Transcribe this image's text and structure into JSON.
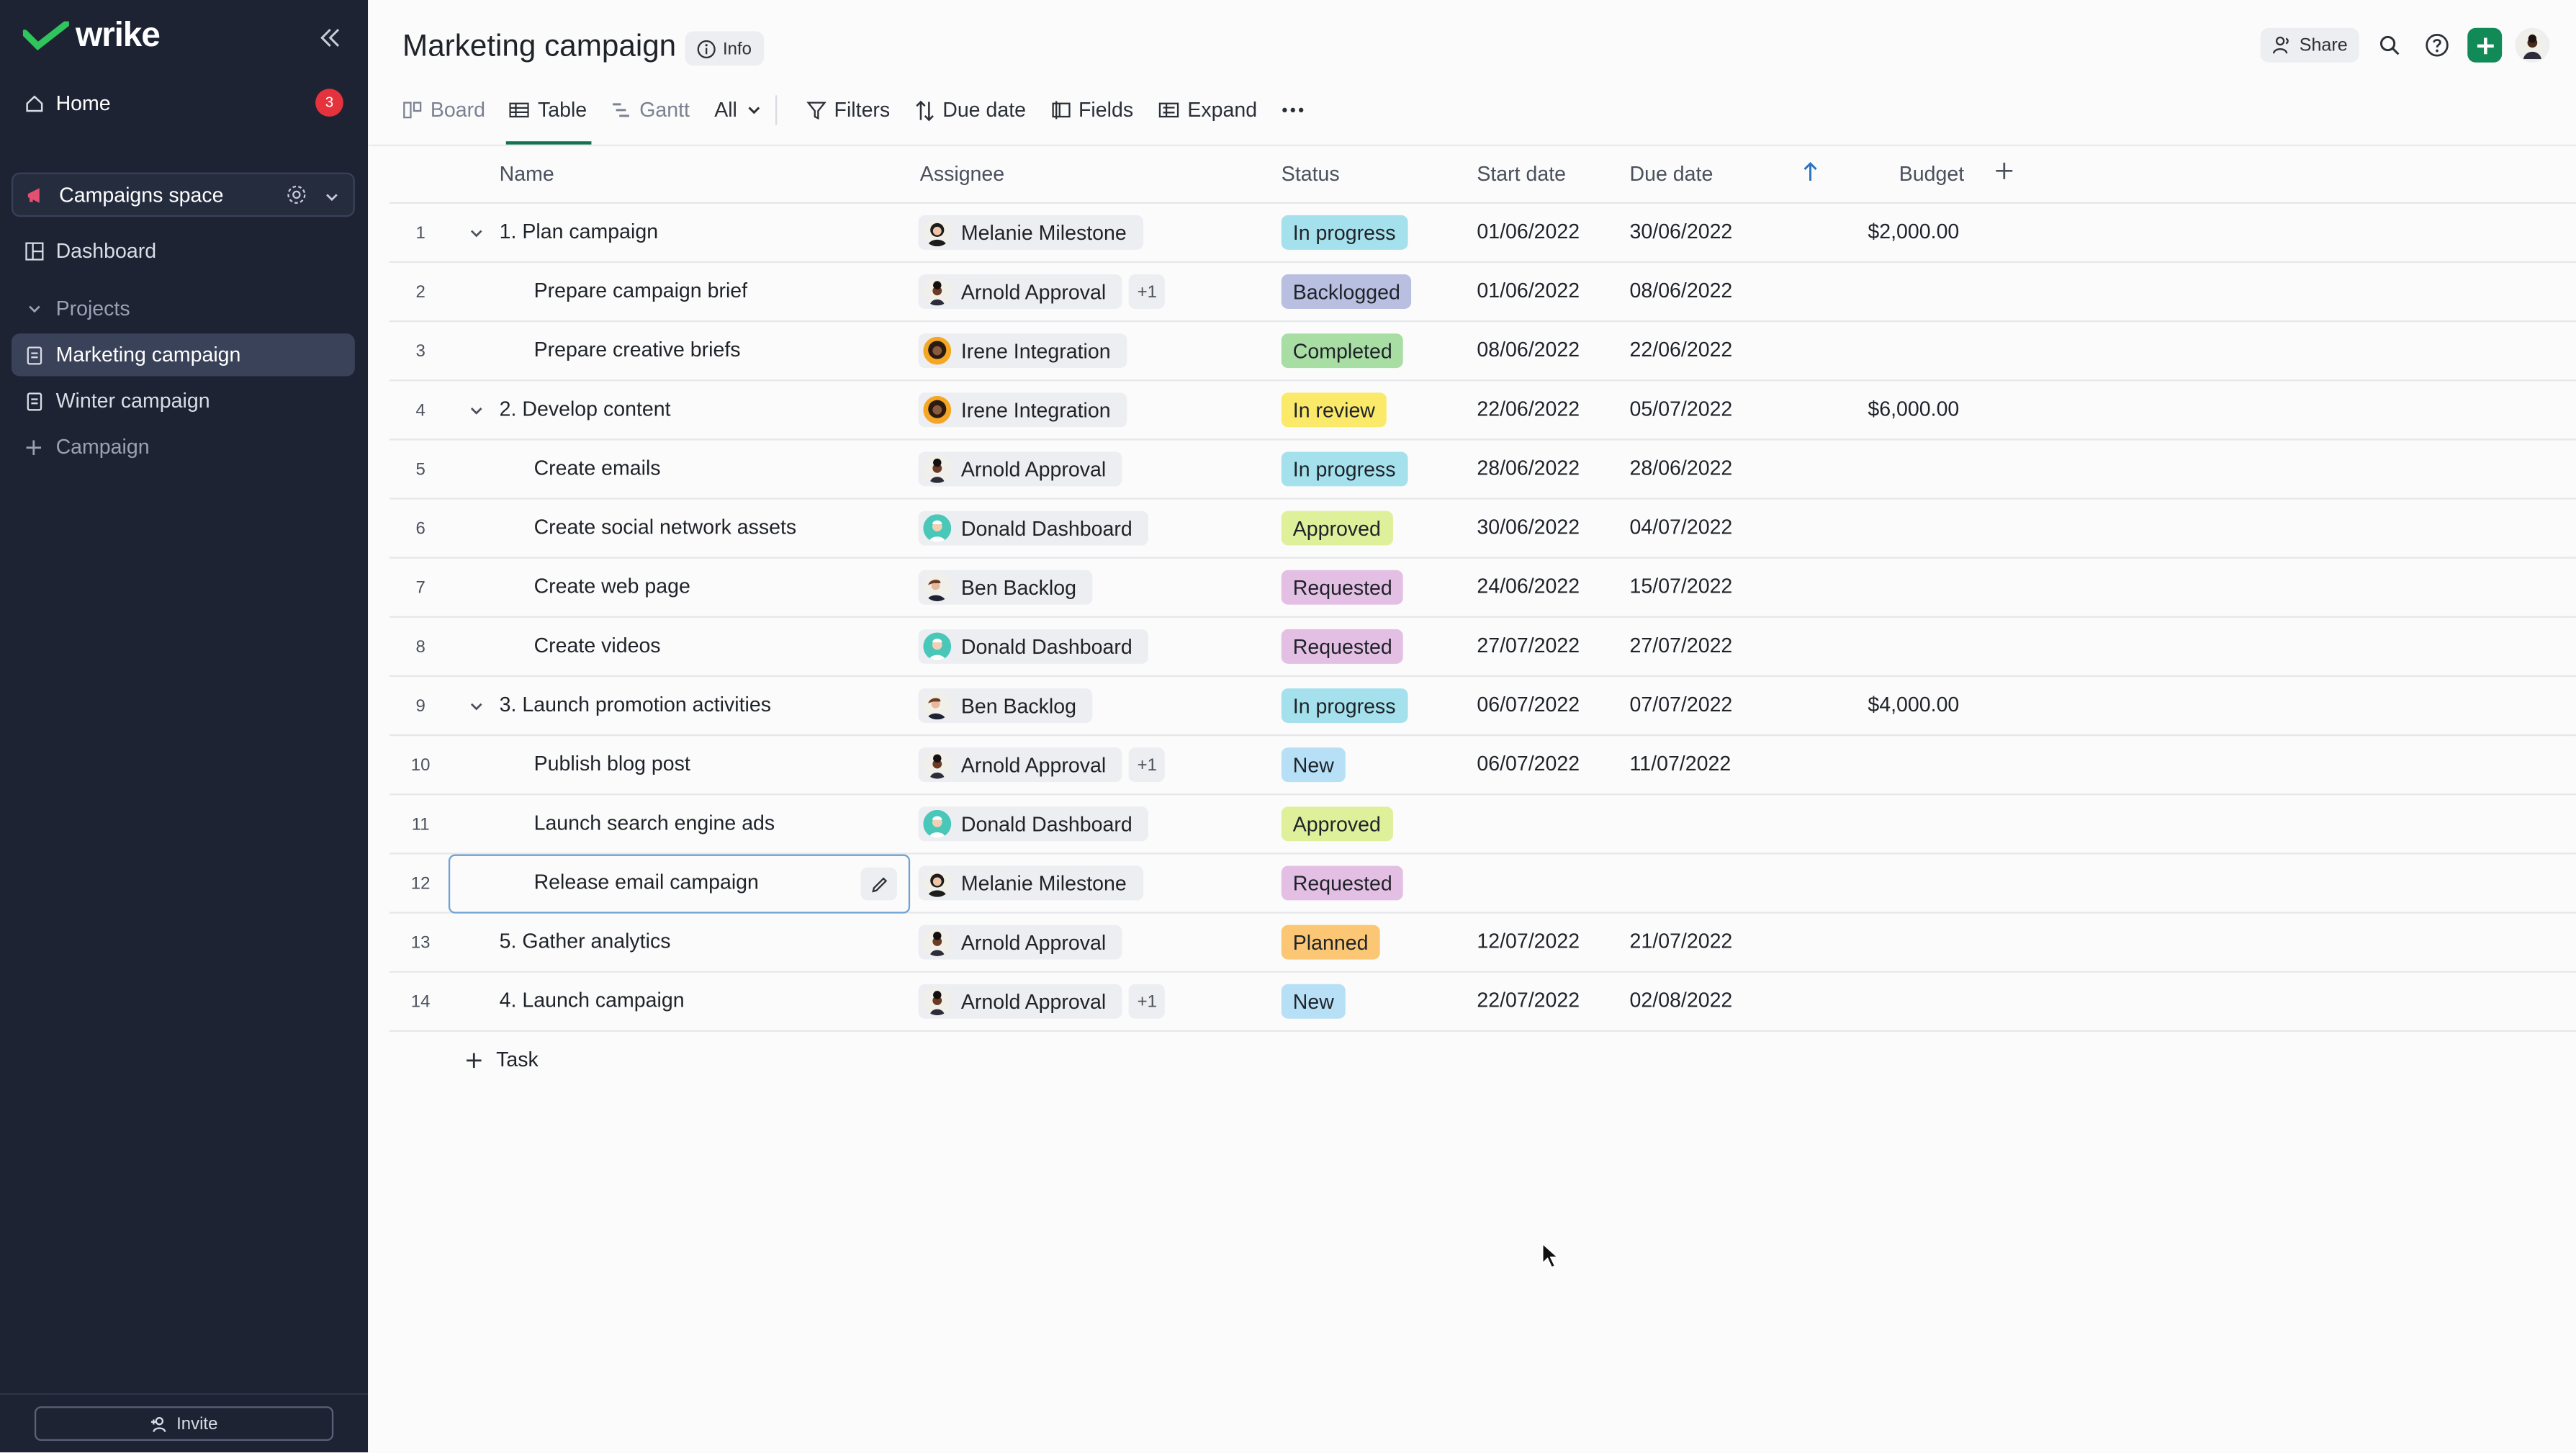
{
  "sidebar": {
    "logo": "wrike",
    "home": {
      "label": "Home",
      "badge": "3"
    },
    "space": {
      "label": "Campaigns space"
    },
    "items": [
      {
        "label": "Dashboard",
        "icon": "dashboard-icon"
      },
      {
        "label": "Projects",
        "icon": "chevron-down-icon"
      },
      {
        "label": "Marketing campaign",
        "icon": "project-icon"
      },
      {
        "label": "Winter campaign",
        "icon": "project-icon"
      },
      {
        "label": "Campaign",
        "icon": "plus-icon"
      }
    ],
    "invite": "Invite"
  },
  "header": {
    "title": "Marketing campaign",
    "info": "Info",
    "share": "Share"
  },
  "toolbar": {
    "views": [
      {
        "label": "Board"
      },
      {
        "label": "Table"
      },
      {
        "label": "Gantt"
      }
    ],
    "filter_scope": "All",
    "actions": [
      {
        "label": "Filters"
      },
      {
        "label": "Due date"
      },
      {
        "label": "Fields"
      },
      {
        "label": "Expand"
      }
    ]
  },
  "table": {
    "columns": {
      "name": "Name",
      "assignee": "Assignee",
      "status": "Status",
      "start": "Start date",
      "due": "Due date",
      "budget": "Budget"
    },
    "rows": [
      {
        "num": "1",
        "name": "1. Plan campaign",
        "assignee": "Melanie Milestone",
        "extra": "",
        "status": "In progress",
        "start": "01/06/2022",
        "due": "30/06/2022",
        "budget": "$2,000.00"
      },
      {
        "num": "2",
        "name": "Prepare campaign brief",
        "assignee": "Arnold Approval",
        "extra": "+1",
        "status": "Backlogged",
        "start": "01/06/2022",
        "due": "08/06/2022",
        "budget": ""
      },
      {
        "num": "3",
        "name": "Prepare creative briefs",
        "assignee": "Irene Integration",
        "extra": "",
        "status": "Completed",
        "start": "08/06/2022",
        "due": "22/06/2022",
        "budget": ""
      },
      {
        "num": "4",
        "name": "2. Develop content",
        "assignee": "Irene Integration",
        "extra": "",
        "status": "In review",
        "start": "22/06/2022",
        "due": "05/07/2022",
        "budget": "$6,000.00"
      },
      {
        "num": "5",
        "name": "Create emails",
        "assignee": "Arnold Approval",
        "extra": "",
        "status": "In progress",
        "start": "28/06/2022",
        "due": "28/06/2022",
        "budget": ""
      },
      {
        "num": "6",
        "name": "Create social network assets",
        "assignee": "Donald Dashboard",
        "extra": "",
        "status": "Approved",
        "start": "30/06/2022",
        "due": "04/07/2022",
        "budget": ""
      },
      {
        "num": "7",
        "name": "Create web page",
        "assignee": "Ben Backlog",
        "extra": "",
        "status": "Requested",
        "start": "24/06/2022",
        "due": "15/07/2022",
        "budget": ""
      },
      {
        "num": "8",
        "name": "Create videos",
        "assignee": "Donald Dashboard",
        "extra": "",
        "status": "Requested",
        "start": "27/07/2022",
        "due": "27/07/2022",
        "budget": ""
      },
      {
        "num": "9",
        "name": "3. Launch promotion activities",
        "assignee": "Ben Backlog",
        "extra": "",
        "status": "In progress",
        "start": "06/07/2022",
        "due": "07/07/2022",
        "budget": "$4,000.00"
      },
      {
        "num": "10",
        "name": "Publish blog post",
        "assignee": "Arnold Approval",
        "extra": "+1",
        "status": "New",
        "start": "06/07/2022",
        "due": "11/07/2022",
        "budget": ""
      },
      {
        "num": "11",
        "name": "Launch search engine ads",
        "assignee": "Donald Dashboard",
        "extra": "",
        "status": "Approved",
        "start": "",
        "due": "",
        "budget": ""
      },
      {
        "num": "12",
        "name": "Release email campaign",
        "assignee": "Melanie Milestone",
        "extra": "",
        "status": "Requested",
        "start": "",
        "due": "",
        "budget": ""
      },
      {
        "num": "13",
        "name": "5. Gather analytics",
        "assignee": "Arnold Approval",
        "extra": "",
        "status": "Planned",
        "start": "12/07/2022",
        "due": "21/07/2022",
        "budget": ""
      },
      {
        "num": "14",
        "name": "4. Launch campaign",
        "assignee": "Arnold Approval",
        "extra": "+1",
        "status": "New",
        "start": "22/07/2022",
        "due": "02/08/2022",
        "budget": ""
      }
    ],
    "add_task": "Task"
  },
  "status_colors": {
    "In progress": "#a4e1ec",
    "Backlogged": "#b9bfe0",
    "Completed": "#a8dea4",
    "In review": "#fbe969",
    "Approved": "#dff09a",
    "Requested": "#e4bfe4",
    "New": "#b7e0f7",
    "Planned": "#fbc774"
  }
}
